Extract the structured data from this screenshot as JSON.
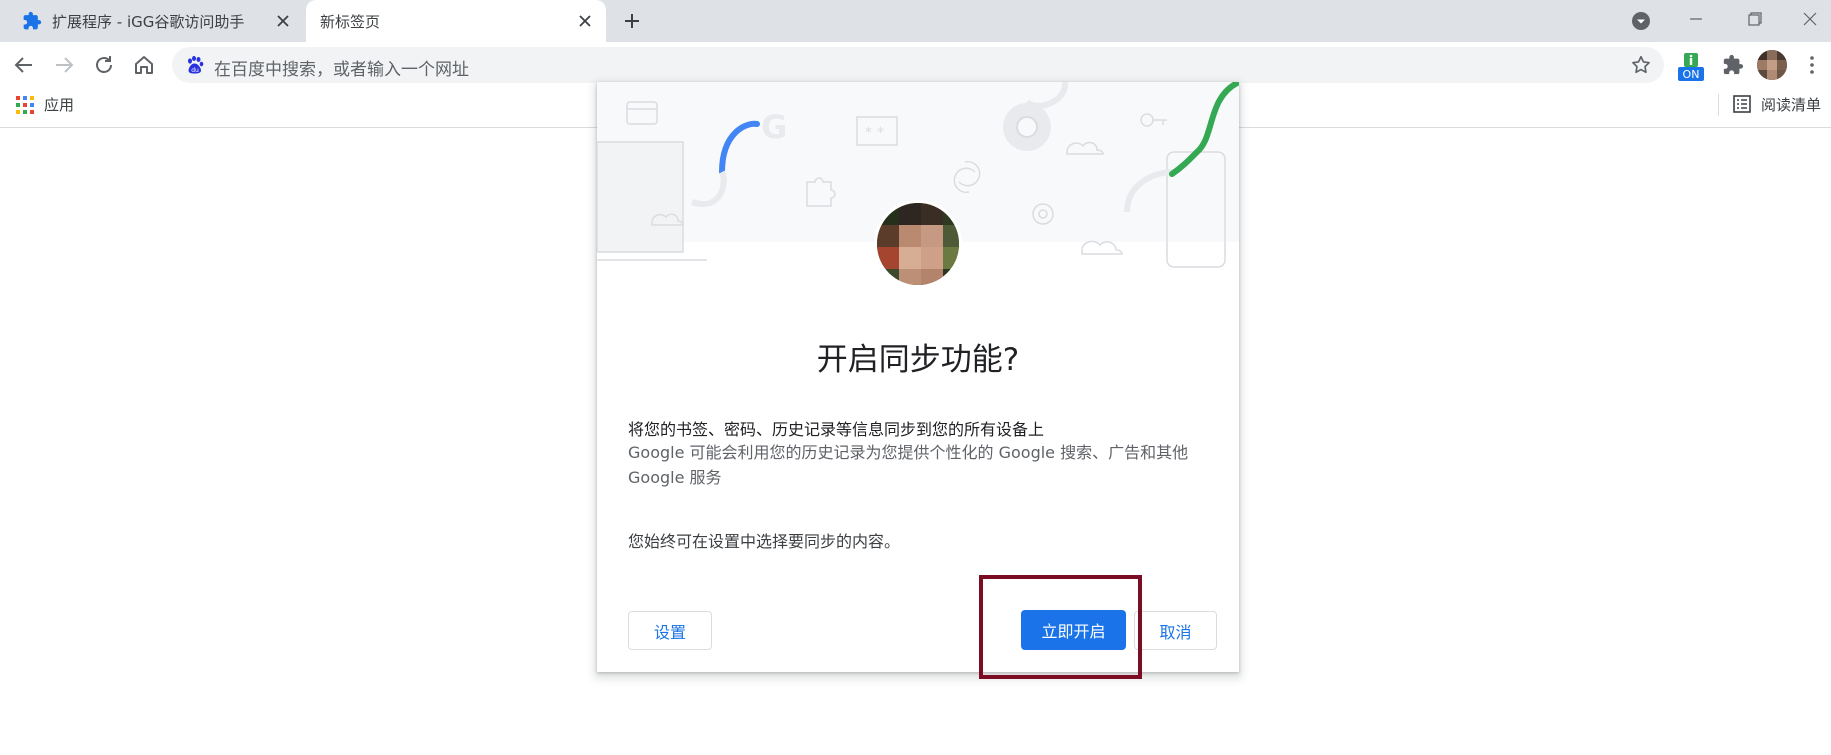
{
  "tabs": [
    {
      "title": "扩展程序 - iGG谷歌访问助手",
      "active": false
    },
    {
      "title": "新标签页",
      "active": true
    }
  ],
  "address_bar": {
    "placeholder": "在百度中搜索，或者输入一个网址"
  },
  "extension_badge": "ON",
  "bookmarks": {
    "apps_label": "应用",
    "reading_list_label": "阅读清单"
  },
  "sync_dialog": {
    "title": "开启同步功能?",
    "description_primary": "将您的书签、密码、历史记录等信息同步到您的所有设备上",
    "description_secondary": "Google 可能会利用您的历史记录为您提供个性化的 Google 搜索、广告和其他 Google 服务",
    "settings_note": "您始终可在设置中选择要同步的内容。",
    "settings_button": "设置",
    "enable_button": "立即开启",
    "cancel_button": "取消"
  },
  "colors": {
    "tabstrip_bg": "#dee1e6",
    "accent_blue": "#1a73e8",
    "google_green": "#34a853",
    "google_blue": "#4285f4",
    "highlight_box": "#7b0c24"
  }
}
